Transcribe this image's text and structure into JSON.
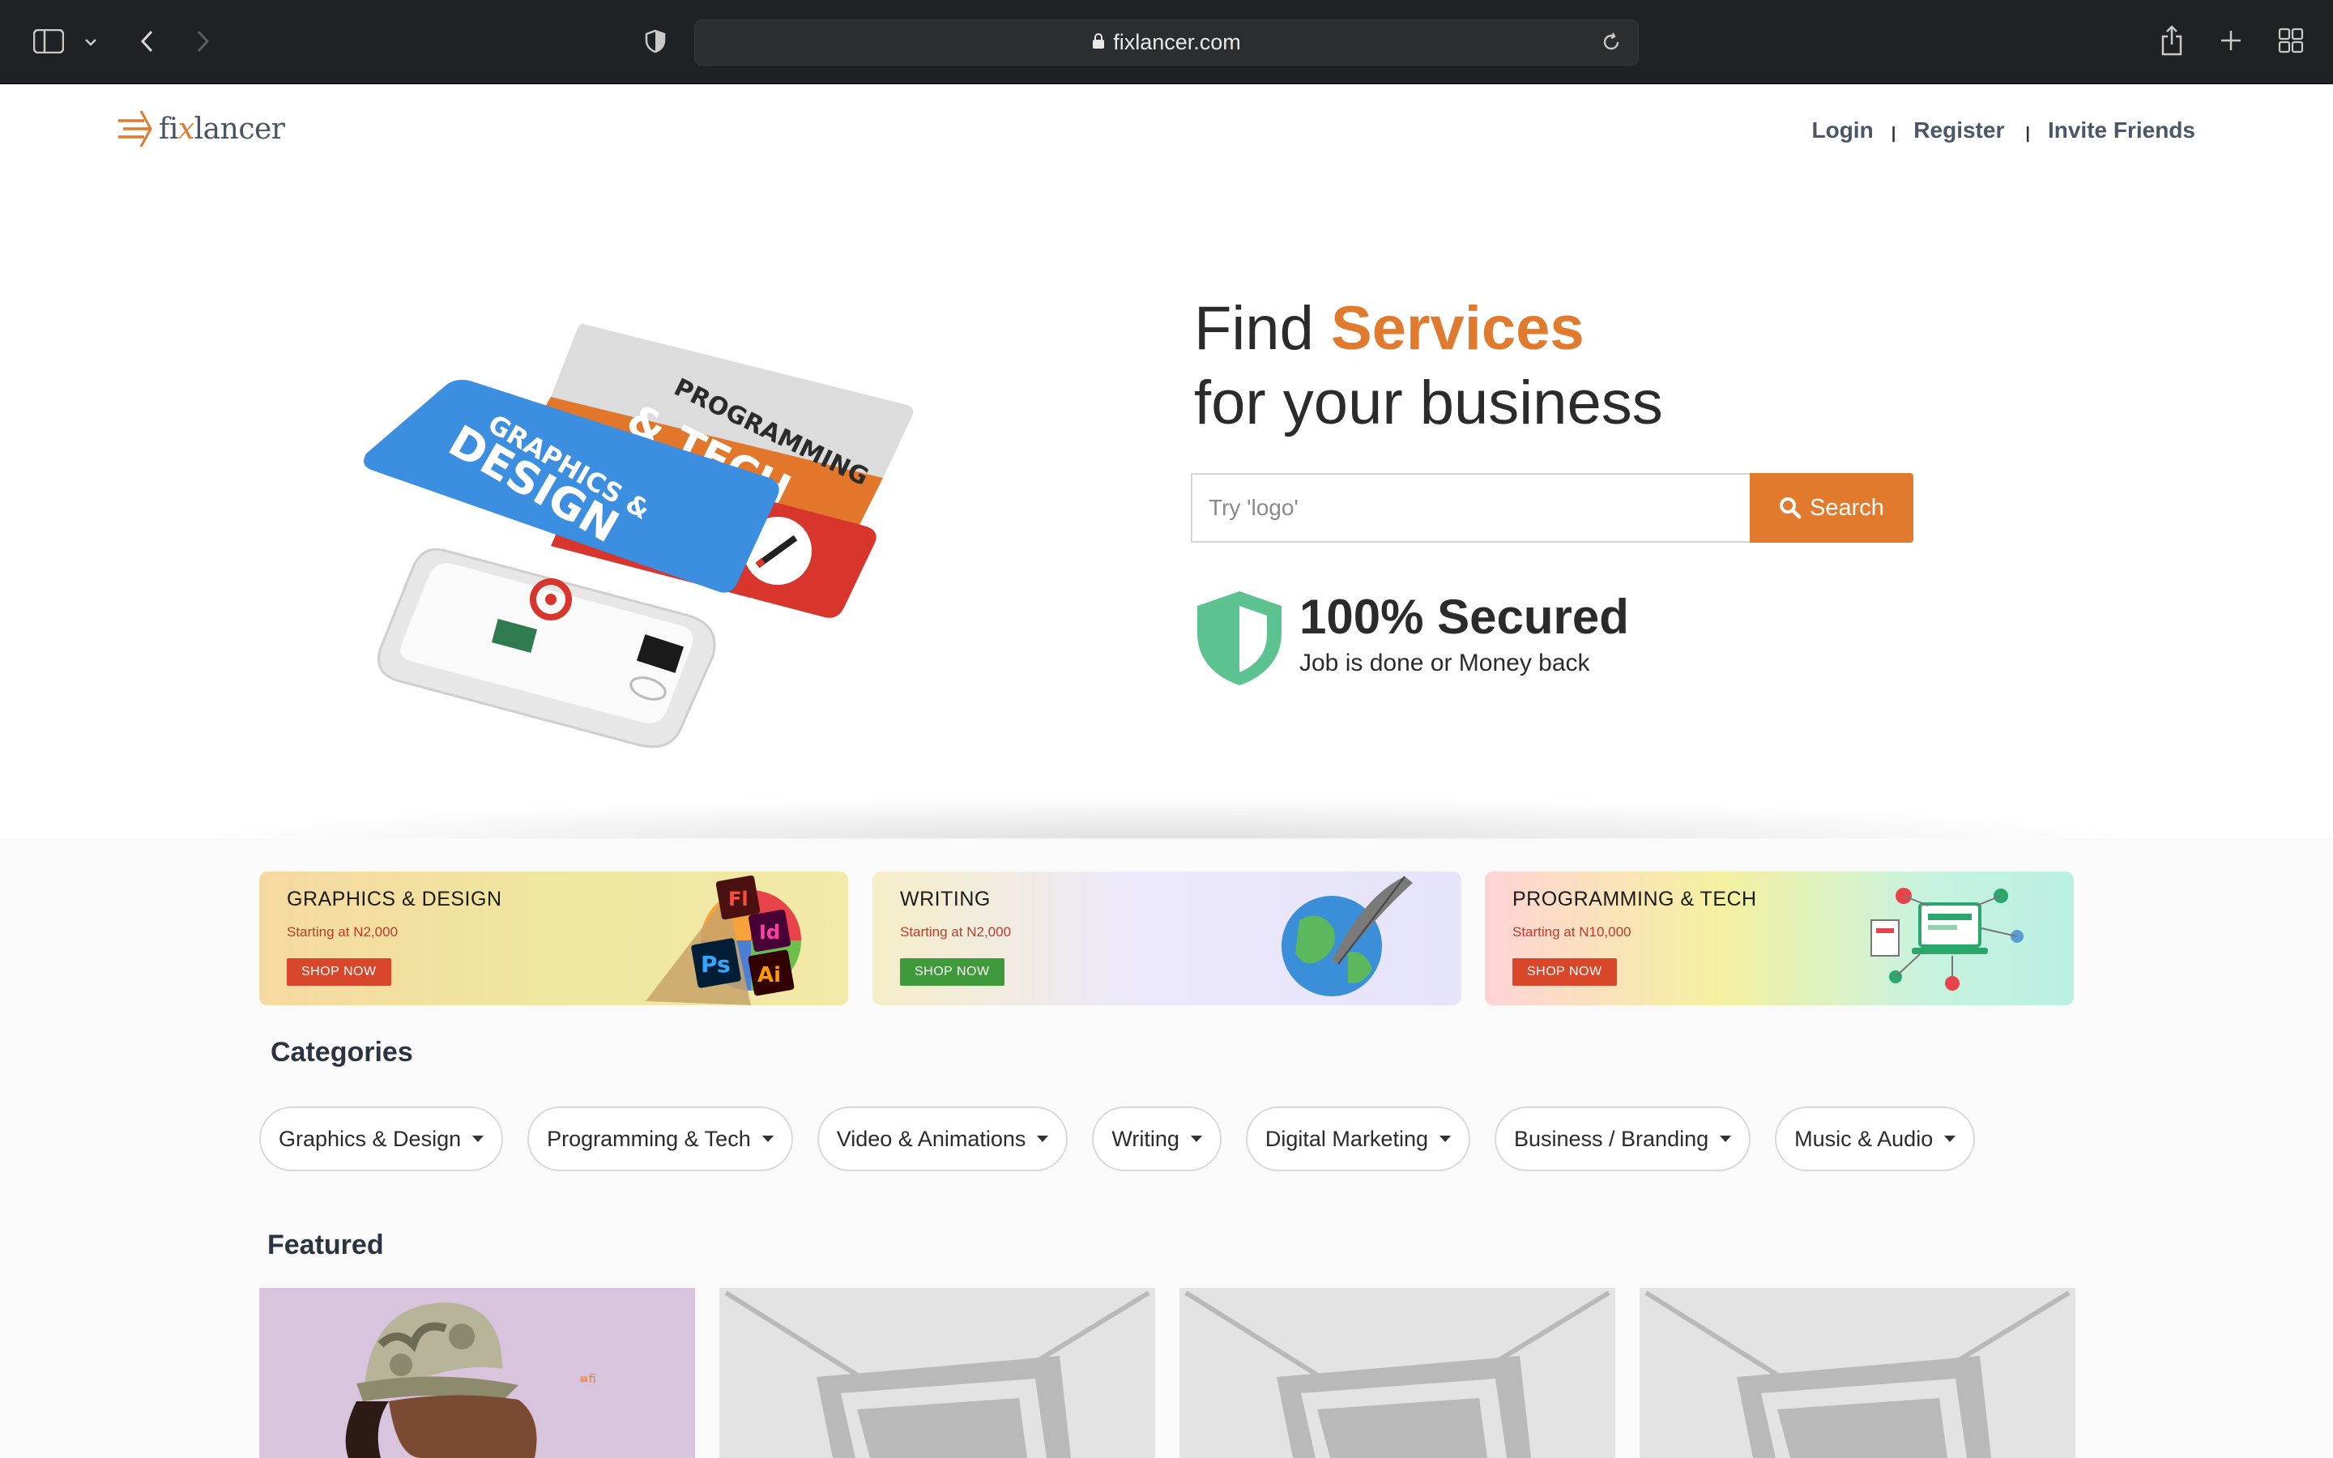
{
  "browser": {
    "url": "fixlancer.com"
  },
  "header": {
    "logo_prefix": "fi",
    "logo_x": "x",
    "logo_suffix": "lancer",
    "nav": {
      "login": "Login",
      "register": "Register",
      "invite": "Invite Friends"
    }
  },
  "hero": {
    "title_prefix": "Find ",
    "title_accent": "Services",
    "title_line2": "for your business",
    "search_placeholder": "Try 'logo'",
    "search_button": "Search",
    "secured_title": "100% Secured",
    "secured_sub": "Job is done or Money back",
    "illustration_labels": {
      "card1": "GRAPHICS &",
      "card1b": "DESIGN",
      "card2": "PROGRAMMING",
      "card2b": "& TECH",
      "card3": "WRITING"
    }
  },
  "promos": [
    {
      "title": "GRAPHICS & DESIGN",
      "sub": "Starting at N2,000",
      "button": "SHOP NOW",
      "bg": "#f2e79a",
      "btn_color": "#d9472b",
      "sub_color": "#c0392b"
    },
    {
      "title": "WRITING",
      "sub": "Starting at N2,000",
      "button": "SHOP NOW",
      "bg": "#ece8fb",
      "btn_color": "#3e9a3a",
      "sub_color": "#c0392b"
    },
    {
      "title": "PROGRAMMING & TECH",
      "sub": "Starting at N10,000",
      "button": "SHOP NOW",
      "bg": "#c8f2e0",
      "btn_color": "#d9472b",
      "sub_color": "#c0392b"
    }
  ],
  "categories": {
    "heading": "Categories",
    "items": [
      "Graphics & Design",
      "Programming & Tech",
      "Video & Animations",
      "Writing",
      "Digital Marketing",
      "Business / Branding",
      "Music & Audio"
    ]
  },
  "featured": {
    "heading": "Featured"
  },
  "colors": {
    "accent": "#e07a2e",
    "shield": "#5cc28f",
    "card_blue": "#3b8ee0",
    "card_orange": "#e2762b",
    "card_red": "#d8352c"
  }
}
